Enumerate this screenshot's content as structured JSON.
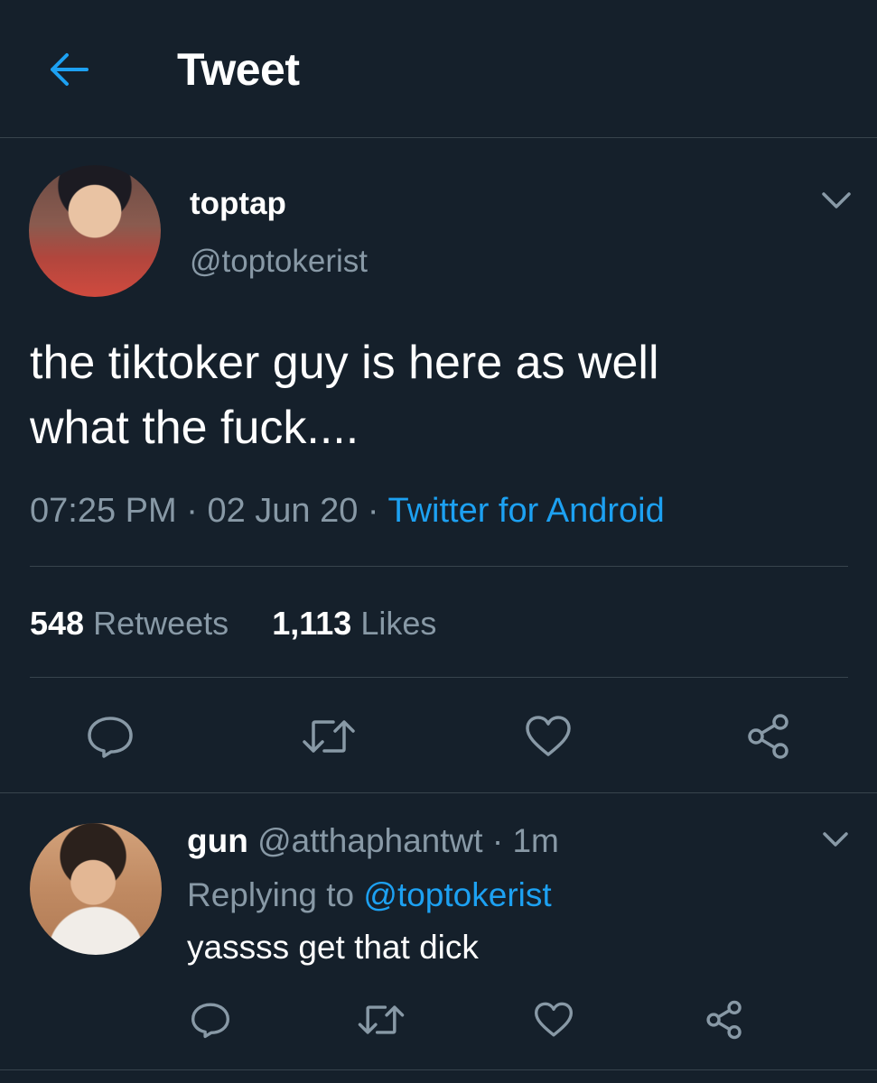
{
  "header": {
    "title": "Tweet"
  },
  "tweet": {
    "name": "toptap",
    "handle": "@toptokerist",
    "text_line1": "the tiktoker guy is here as well",
    "text_line2": "what the fuck....",
    "time": "07:25 PM",
    "date": "02 Jun 20",
    "source": "Twitter for Android",
    "retweets_count": "548",
    "retweets_label": "Retweets",
    "likes_count": "1,113",
    "likes_label": "Likes"
  },
  "reply": {
    "name": "gun",
    "handle": "@atthaphantwt",
    "age": "1m",
    "replying_label": "Replying to",
    "replying_to": "@toptokerist",
    "text": "yassss get that dick"
  },
  "colors": {
    "accent": "#1da1f2",
    "background": "#15202b",
    "secondary_text": "#8899a6",
    "divider": "#38444d"
  },
  "icons": [
    "back-arrow-icon",
    "chevron-down-icon",
    "reply-icon",
    "retweet-icon",
    "like-icon",
    "share-icon"
  ]
}
